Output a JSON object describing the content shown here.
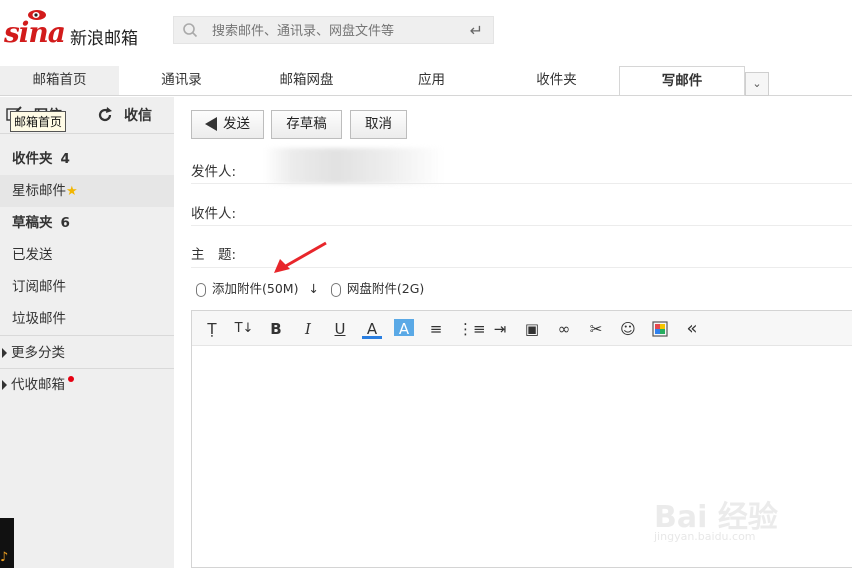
{
  "header": {
    "logo_text": "sina",
    "brand_name": "新浪邮箱",
    "search_placeholder": "搜索邮件、通讯录、网盘文件等",
    "enter_icon": "enter-icon"
  },
  "tabs": [
    "邮箱首页",
    "通讯录",
    "邮箱网盘",
    "应用",
    "收件夹",
    "写邮件"
  ],
  "active_tab": "写邮件",
  "sidebar": {
    "write_label": "写信",
    "receive_label": "收信",
    "tooltip": "邮箱首页",
    "items": [
      {
        "label": "收件夹",
        "count": "4"
      },
      {
        "label": "星标邮件"
      },
      {
        "label": "草稿夹",
        "count": "6"
      },
      {
        "label": "已发送"
      },
      {
        "label": "订阅邮件"
      },
      {
        "label": "垃圾邮件"
      },
      {
        "label": "更多分类"
      },
      {
        "label": "代收邮箱"
      }
    ]
  },
  "compose": {
    "send_label": "发送",
    "draft_label": "存草稿",
    "cancel_label": "取消",
    "from_label": "发件人:",
    "to_label": "收件人:",
    "subject_label": "主　题:",
    "attach_label": "添加附件(50M)",
    "attach_arrow": "↓",
    "netdisk_attach_label": "网盘附件(2G)"
  },
  "toolbar_icons": [
    "font-family-icon",
    "font-size-icon",
    "bold-icon",
    "italic-icon",
    "underline-icon",
    "font-color-icon",
    "background-color-icon",
    "align-icon",
    "list-icon",
    "indent-icon",
    "image-icon",
    "link-icon",
    "scissors-icon",
    "emoji-icon",
    "color-palette-icon",
    "collapse-icon"
  ],
  "colors": {
    "brand_red": "#d21b1b",
    "sidebar_bg": "#efefef",
    "annotation_red": "#e8262b"
  },
  "watermark": {
    "text": "Bai 经验",
    "url": "jingyan.baidu.com"
  }
}
